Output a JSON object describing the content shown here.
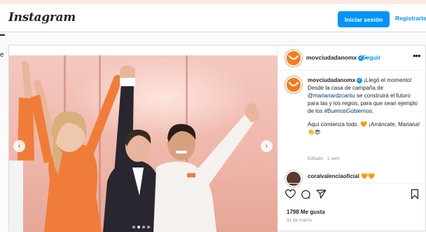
{
  "header": {
    "logo_text": "Instagram",
    "login_label": "Iniciar sesión",
    "register_label": "Registrarte"
  },
  "sidebar": {
    "letter": "e"
  },
  "post": {
    "username": "movciudadanomx",
    "follow_label": "Seguir",
    "separator": "•",
    "caption": {
      "part1": "¡Llegó el momento! Desde la casa de campaña de ",
      "mention1": "@marianardzcantu",
      "part2": " se construirá el futuro para las y los regios, para que sean ejemplo de los ",
      "hashtag": "#BuenosGobiernos",
      "part3": ".",
      "line2": "Aquí comienza todo. 🧡 ¡Arráncate, Mariana! 👏😎"
    },
    "edited_text": "Editado · 1 sem",
    "comment_username": "coralvalenciaoficial 🧡🧡",
    "likes_text": "1798 Me gusta",
    "date_text": "31 de marzo"
  },
  "colors": {
    "accent": "#0095f6",
    "brand_orange": "#f47b20",
    "verified": "#1d9bf0"
  },
  "icons": [
    "heart-icon",
    "comment-icon",
    "share-icon",
    "save-icon",
    "more-icon",
    "verified-icon",
    "chevron-left-icon",
    "chevron-right-icon"
  ]
}
